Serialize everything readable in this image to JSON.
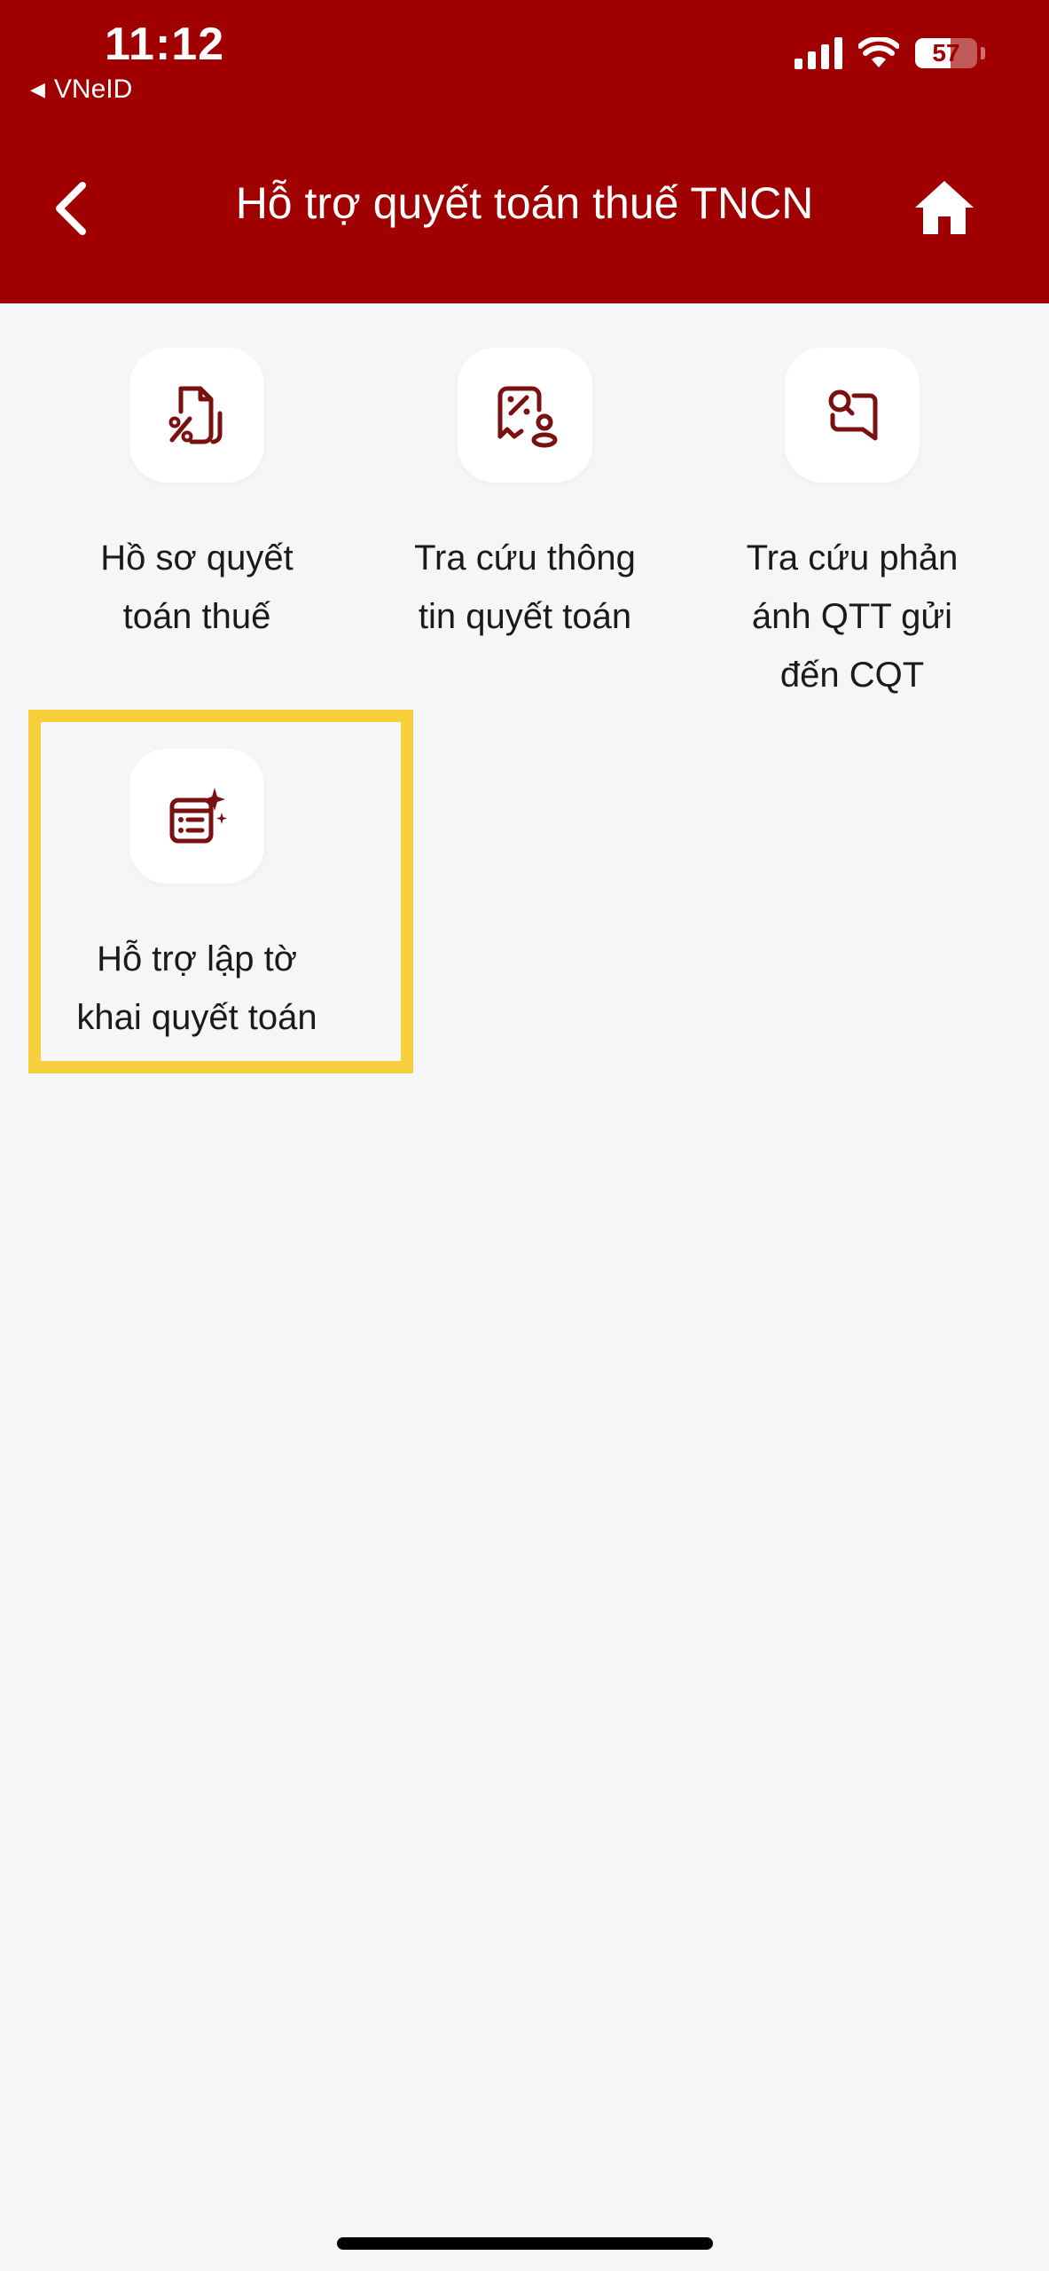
{
  "status_bar": {
    "time": "11:12",
    "back_app_label": "VNeID",
    "battery_level": "57"
  },
  "header": {
    "title": "Hỗ trợ quyết toán thuế TNCN"
  },
  "menu": {
    "items": [
      {
        "label": "Hồ sơ quyết\ntoán thuế",
        "icon": "tax-document-icon"
      },
      {
        "label": "Tra cứu thông\ntin quyết toán",
        "icon": "tax-lookup-icon"
      },
      {
        "label": "Tra cứu phản\nánh QTT gửi\nđến CQT",
        "icon": "feedback-lookup-icon"
      },
      {
        "label": "Hỗ trợ lập tờ\nkhai quyết toán",
        "icon": "form-assist-icon"
      }
    ]
  },
  "colors": {
    "header_bg": "#a00000",
    "icon_color": "#7a1010",
    "highlight": "#f7cf3c",
    "page_bg": "#f5f6f8"
  }
}
